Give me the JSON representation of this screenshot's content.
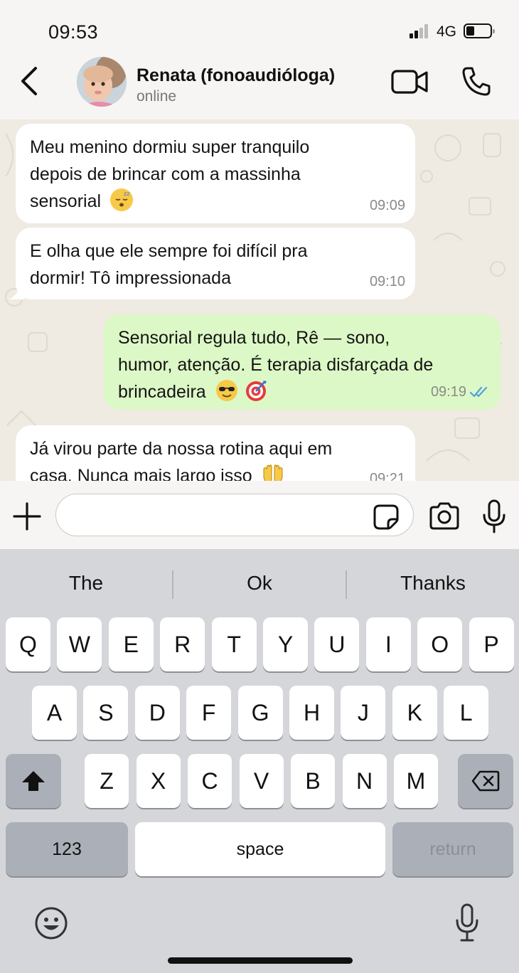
{
  "status_bar": {
    "time": "09:53",
    "network": "4G",
    "battery_level": 0.35,
    "signal_bars": 2
  },
  "header": {
    "contact_name": "Renata (fonoaudióloga)",
    "contact_status": "online",
    "icons": [
      "back-icon",
      "video-call-icon",
      "phone-icon"
    ]
  },
  "messages": [
    {
      "direction": "in",
      "text": "Meu menino dormiu super tranquilo\ndepois de brincar com a massinha\nsensorial",
      "emoji": [
        "sleeping-face"
      ],
      "time": "09:09"
    },
    {
      "direction": "in",
      "text": "E olha que ele sempre foi difícil pra\ndormir! Tô impressionada",
      "emoji": [],
      "time": "09:10"
    },
    {
      "direction": "out",
      "text": "Sensorial regula tudo, Rê — sono,\nhumor, atenção. É terapia disfarçada de\nbrincadeira",
      "emoji": [
        "sunglasses-face",
        "direct-hit"
      ],
      "time": "09:19",
      "read": true
    },
    {
      "direction": "in",
      "text": "Já virou parte da nossa rotina aqui em\ncasa. Nunca mais largo isso",
      "emoji": [
        "raising-hands"
      ],
      "time": "09:21"
    }
  ],
  "composer": {
    "placeholder": "",
    "icons": [
      "plus-icon",
      "sticker-icon",
      "camera-icon",
      "microphone-icon"
    ]
  },
  "keyboard": {
    "suggestions": [
      "The",
      "Ok",
      "Thanks"
    ],
    "row1": [
      "Q",
      "W",
      "E",
      "R",
      "T",
      "Y",
      "U",
      "I",
      "O",
      "P"
    ],
    "row2": [
      "A",
      "S",
      "D",
      "F",
      "G",
      "H",
      "J",
      "K",
      "L"
    ],
    "row3": [
      "Z",
      "X",
      "C",
      "V",
      "B",
      "N",
      "M"
    ],
    "numbers_label": "123",
    "space_label": "space",
    "return_label": "return",
    "icons": [
      "shift-icon",
      "backspace-icon",
      "emoji-icon",
      "dictation-icon"
    ]
  },
  "colors": {
    "incoming_bubble": "#ffffff",
    "outgoing_bubble": "#dcf8c6",
    "read_receipt": "#4fa3e0",
    "chat_background": "#efeae2"
  }
}
